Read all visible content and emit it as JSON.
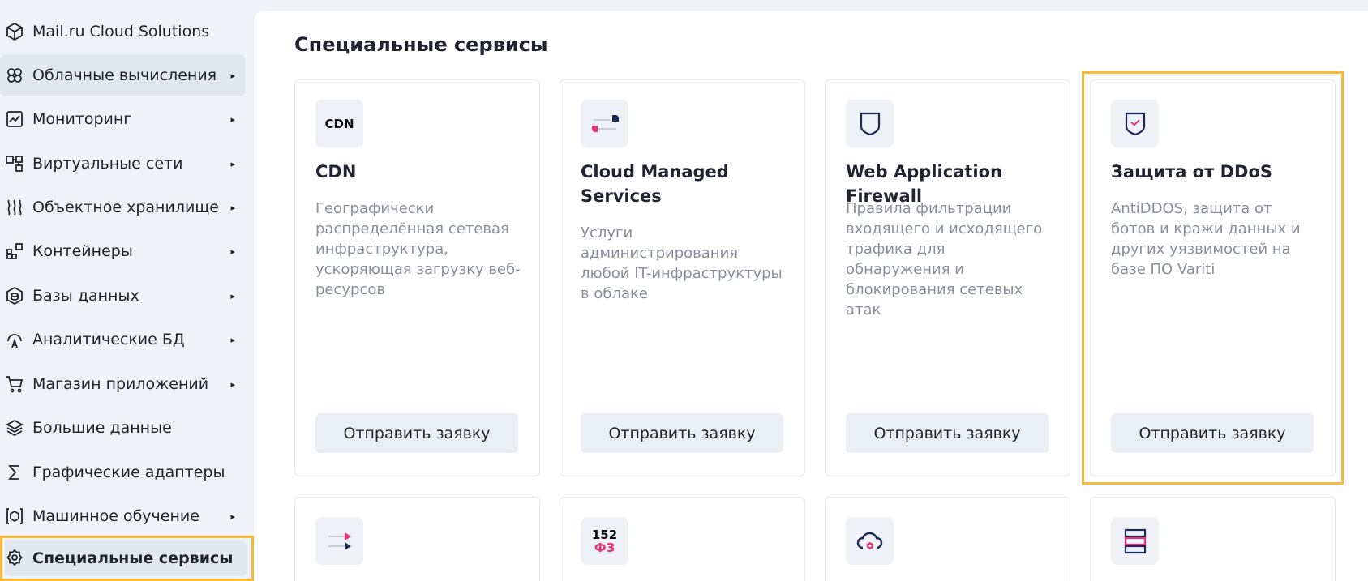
{
  "sidebar": {
    "items": [
      {
        "label": "Mail.ru Cloud Solutions",
        "icon": "cube-icon",
        "arrow": ""
      },
      {
        "label": "Облачные вычисления",
        "icon": "cloud-compute-icon",
        "arrow": "▸"
      },
      {
        "label": "Мониторинг",
        "icon": "chart-icon",
        "arrow": "▸"
      },
      {
        "label": "Виртуальные сети",
        "icon": "network-icon",
        "arrow": "▸"
      },
      {
        "label": "Объектное хранилище",
        "icon": "storage-icon",
        "arrow": "▸"
      },
      {
        "label": "Контейнеры",
        "icon": "containers-icon",
        "arrow": "▸"
      },
      {
        "label": "Базы данных",
        "icon": "database-icon",
        "arrow": "▸"
      },
      {
        "label": "Аналитические БД",
        "icon": "analytics-db-icon",
        "arrow": "▸"
      },
      {
        "label": "Магазин приложений",
        "icon": "cart-icon",
        "arrow": "▸"
      },
      {
        "label": "Большие данные",
        "icon": "bigdata-icon",
        "arrow": ""
      },
      {
        "label": "Графические адаптеры",
        "icon": "sigma-icon",
        "arrow": ""
      },
      {
        "label": "Машинное обучение",
        "icon": "ml-icon",
        "arrow": "▸"
      },
      {
        "label": "Специальные сервисы",
        "icon": "gear-icon",
        "arrow": ""
      }
    ]
  },
  "main": {
    "title": "Специальные сервисы",
    "cards": [
      {
        "icon_text": "CDN",
        "title": "CDN",
        "desc": "Географически распределённая сетевая инфраструктура, ускоряющая загрузку веб-ресурсов",
        "button": "Отправить заявку"
      },
      {
        "icon_text": "",
        "title": "Cloud Managed Services",
        "desc": "Услуги администрирования любой IT-инфраструктуры в облаке",
        "button": "Отправить заявку"
      },
      {
        "icon_text": "",
        "title": "Web Application Firewall",
        "desc": "Правила фильтрации входящего и исходящего трафика для обнаружения и блокирования сетевых атак",
        "button": "Отправить заявку"
      },
      {
        "icon_text": "",
        "title": "Защита от DDoS",
        "desc": "AntiDDOS, защита от ботов и кражи данных и других уязвимостей на базе ПО Variti",
        "button": "Отправить заявку"
      }
    ],
    "row2_icons": [
      {
        "icon": "transfer-icon",
        "text": ""
      },
      {
        "icon": "fz152-icon",
        "text_top": "152",
        "text_bottom": "ФЗ"
      },
      {
        "icon": "cloud-hex-icon",
        "text": ""
      },
      {
        "icon": "stack-icon",
        "text": ""
      }
    ]
  },
  "colors": {
    "highlight": "#f9b93a",
    "navy": "#1c2a5a",
    "pink": "#e8337a"
  }
}
